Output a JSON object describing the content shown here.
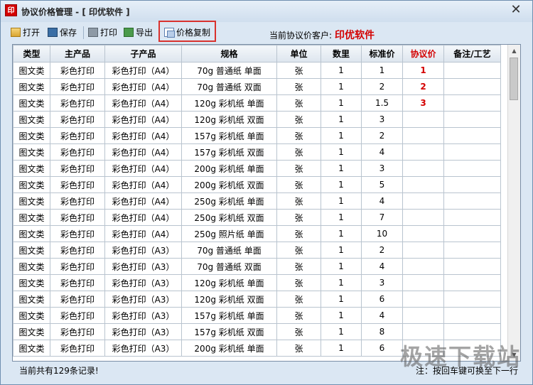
{
  "window": {
    "title": "协议价格管理 - [ 印优软件 ]",
    "icon_text": "印"
  },
  "toolbar": {
    "open_label": "打开",
    "save_label": "保存",
    "print_label": "打印",
    "export_label": "导出",
    "copy_label": "价格复制",
    "customer_label": "当前协议价客户:",
    "customer_name": "印优软件"
  },
  "table": {
    "columns": [
      "类型",
      "主产品",
      "子产品",
      "规格",
      "单位",
      "数里",
      "标准价",
      "协议价",
      "备注/工艺"
    ],
    "rows": [
      [
        "图文类",
        "彩色打印",
        "彩色打印（A4）",
        "70g 普通纸 单面",
        "张",
        "1",
        "1",
        "1",
        ""
      ],
      [
        "图文类",
        "彩色打印",
        "彩色打印（A4）",
        "70g 普通纸 双面",
        "张",
        "1",
        "2",
        "2",
        ""
      ],
      [
        "图文类",
        "彩色打印",
        "彩色打印（A4）",
        "120g 彩机纸 单面",
        "张",
        "1",
        "1.5",
        "3",
        ""
      ],
      [
        "图文类",
        "彩色打印",
        "彩色打印（A4）",
        "120g 彩机纸 双面",
        "张",
        "1",
        "3",
        "",
        ""
      ],
      [
        "图文类",
        "彩色打印",
        "彩色打印（A4）",
        "157g 彩机纸 单面",
        "张",
        "1",
        "2",
        "",
        ""
      ],
      [
        "图文类",
        "彩色打印",
        "彩色打印（A4）",
        "157g 彩机纸 双面",
        "张",
        "1",
        "4",
        "",
        ""
      ],
      [
        "图文类",
        "彩色打印",
        "彩色打印（A4）",
        "200g 彩机纸 单面",
        "张",
        "1",
        "3",
        "",
        ""
      ],
      [
        "图文类",
        "彩色打印",
        "彩色打印（A4）",
        "200g 彩机纸 双面",
        "张",
        "1",
        "5",
        "",
        ""
      ],
      [
        "图文类",
        "彩色打印",
        "彩色打印（A4）",
        "250g 彩机纸 单面",
        "张",
        "1",
        "4",
        "",
        ""
      ],
      [
        "图文类",
        "彩色打印",
        "彩色打印（A4）",
        "250g 彩机纸 双面",
        "张",
        "1",
        "7",
        "",
        ""
      ],
      [
        "图文类",
        "彩色打印",
        "彩色打印（A4）",
        "250g 照片纸 单面",
        "张",
        "1",
        "10",
        "",
        ""
      ],
      [
        "图文类",
        "彩色打印",
        "彩色打印（A3）",
        "70g 普通纸 单面",
        "张",
        "1",
        "2",
        "",
        ""
      ],
      [
        "图文类",
        "彩色打印",
        "彩色打印（A3）",
        "70g 普通纸 双面",
        "张",
        "1",
        "4",
        "",
        ""
      ],
      [
        "图文类",
        "彩色打印",
        "彩色打印（A3）",
        "120g 彩机纸 单面",
        "张",
        "1",
        "3",
        "",
        ""
      ],
      [
        "图文类",
        "彩色打印",
        "彩色打印（A3）",
        "120g 彩机纸 双面",
        "张",
        "1",
        "6",
        "",
        ""
      ],
      [
        "图文类",
        "彩色打印",
        "彩色打印（A3）",
        "157g 彩机纸 单面",
        "张",
        "1",
        "4",
        "",
        ""
      ],
      [
        "图文类",
        "彩色打印",
        "彩色打印（A3）",
        "157g 彩机纸 双面",
        "张",
        "1",
        "8",
        "",
        ""
      ],
      [
        "图文类",
        "彩色打印",
        "彩色打印（A3）",
        "200g 彩机纸 单面",
        "张",
        "1",
        "6",
        "",
        ""
      ]
    ]
  },
  "status": {
    "record_count": "当前共有129条记录!",
    "hint": "注：按回车键可换至下一行"
  },
  "watermark": "极速下载站",
  "colors": {
    "accent_red": "#d40000",
    "highlight_border": "#d9322e"
  },
  "icons": [
    "open-icon",
    "save-icon",
    "print-icon",
    "export-icon",
    "copy-icon",
    "close-icon"
  ]
}
